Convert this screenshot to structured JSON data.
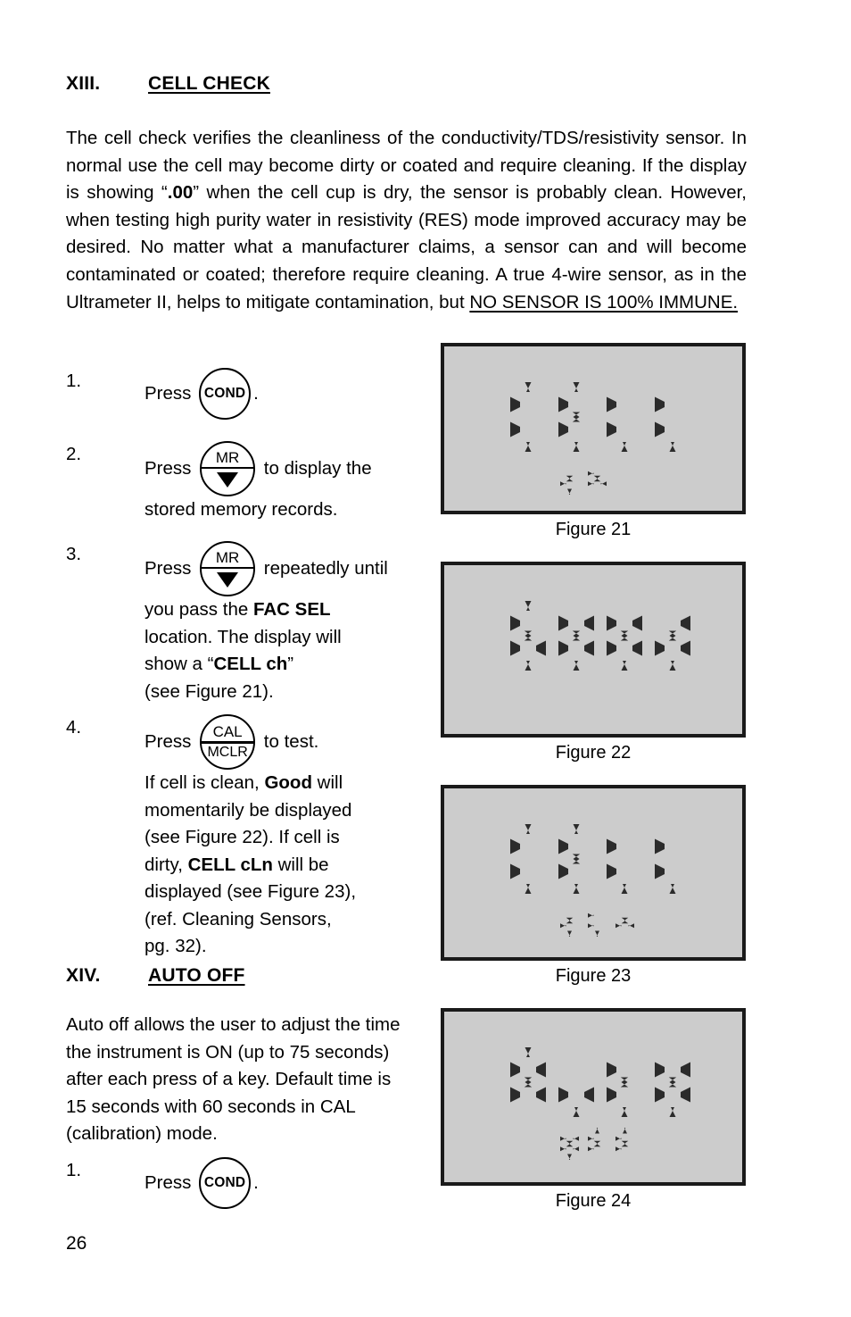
{
  "document": {
    "page_number": "26"
  },
  "sections": {
    "cell_check": {
      "numeral": "XIII.",
      "title": "CELL CHECK",
      "paragraph_parts": [
        {
          "t": "The cell check verifies the cleanliness of the conductivity/TDS/resistivity sensor. In normal use the cell may become dirty or coated and require cleaning. If the display is showing “"
        },
        {
          "t": ".00",
          "bold": true
        },
        {
          "t": "” when the cell cup is dry, the sensor is probably clean. However, when testing high purity water in resistivity (RES) mode improved accuracy may be desired. No matter what a manufacturer claims, a sensor can and will become contaminated or coated; therefore require cleaning. A true 4-wire sensor, as in the Ultrameter II, helps to mitigate contamination, but "
        },
        {
          "t": "NO SENSOR IS 100%  IMMUNE.",
          "underline": true
        }
      ]
    },
    "auto_off": {
      "numeral": "XIV.",
      "title": "AUTO OFF",
      "paragraph": "Auto off allows the user to adjust the time the instrument is ON (up to 75 seconds) after each press of a key. Default time is 15 seconds with 60 seconds in CAL (calibration) mode."
    }
  },
  "steps_cell_check": [
    {
      "index": "1.",
      "lines": [
        {
          "runs": [
            {
              "kind": "text",
              "text": "Press "
            },
            {
              "kind": "key",
              "style": "single",
              "label": "COND"
            },
            {
              "kind": "text",
              "text": "."
            }
          ]
        }
      ]
    },
    {
      "index": "2.",
      "lines": [
        {
          "runs": [
            {
              "kind": "text",
              "text": "Press "
            },
            {
              "kind": "key",
              "style": "split-arrow",
              "top": "MR",
              "bottom": "▼"
            },
            {
              "kind": "text",
              "text": " to display the"
            }
          ]
        },
        {
          "runs": [
            {
              "kind": "text",
              "text": "stored memory records."
            }
          ]
        }
      ]
    },
    {
      "index": "3.",
      "lines": [
        {
          "runs": [
            {
              "kind": "text",
              "text": "Press "
            },
            {
              "kind": "key",
              "style": "split-arrow",
              "top": "MR",
              "bottom": "▼"
            },
            {
              "kind": "text",
              "text": " repeatedly until"
            }
          ]
        },
        {
          "runs": [
            {
              "kind": "text",
              "text": "you pass the "
            },
            {
              "kind": "text",
              "text": "FAC SEL",
              "bold": true
            }
          ]
        },
        {
          "runs": [
            {
              "kind": "text",
              "text": "location. The display will"
            }
          ]
        },
        {
          "runs": [
            {
              "kind": "text",
              "text": "show a “"
            },
            {
              "kind": "text",
              "text": "CELL ch",
              "bold": true
            },
            {
              "kind": "text",
              "text": "”"
            }
          ]
        },
        {
          "runs": [
            {
              "kind": "text",
              "text": "(see Figure 21)."
            }
          ]
        }
      ]
    },
    {
      "index": "4.",
      "lines": [
        {
          "runs": [
            {
              "kind": "text",
              "text": "Press "
            },
            {
              "kind": "key",
              "style": "split-text",
              "top": "CAL",
              "bottom": "MCLR"
            },
            {
              "kind": "text",
              "text": " to test."
            }
          ]
        },
        {
          "runs": [
            {
              "kind": "text",
              "text": "If cell is clean, "
            },
            {
              "kind": "text",
              "text": "Good",
              "bold": true
            },
            {
              "kind": "text",
              "text": " will"
            }
          ]
        },
        {
          "runs": [
            {
              "kind": "text",
              "text": "momentarily be displayed"
            }
          ]
        },
        {
          "runs": [
            {
              "kind": "text",
              "text": "(see Figure 22). If cell is"
            }
          ]
        },
        {
          "runs": [
            {
              "kind": "text",
              "text": "dirty, "
            },
            {
              "kind": "text",
              "text": "CELL cLn",
              "bold": true
            },
            {
              "kind": "text",
              "text": " will be"
            }
          ]
        },
        {
          "runs": [
            {
              "kind": "text",
              "text": "displayed (see Figure 23),"
            }
          ]
        },
        {
          "runs": [
            {
              "kind": "text",
              "text": "(ref. Cleaning Sensors,"
            }
          ]
        },
        {
          "runs": [
            {
              "kind": "text",
              "text": "pg. 32)."
            }
          ]
        }
      ]
    }
  ],
  "steps_auto_off": [
    {
      "index": "1.",
      "lines": [
        {
          "runs": [
            {
              "kind": "text",
              "text": "Press "
            },
            {
              "kind": "key",
              "style": "single",
              "label": "COND"
            },
            {
              "kind": "text",
              "text": "."
            }
          ]
        }
      ]
    }
  ],
  "figures": [
    {
      "id": "figure-21",
      "caption": "Figure 21",
      "lcd": {
        "background": "#cccccc",
        "segment_color": "#2b2b2b",
        "main_text": "CELL",
        "sub_text": "ch",
        "sub_offset_chars": 1
      }
    },
    {
      "id": "figure-22",
      "caption": "Figure 22",
      "lcd": {
        "background": "#cccccc",
        "segment_color": "#2b2b2b",
        "main_text": "Good",
        "sub_text": "",
        "sub_offset_chars": 0
      }
    },
    {
      "id": "figure-23",
      "caption": "Figure 23",
      "lcd": {
        "background": "#cccccc",
        "segment_color": "#2b2b2b",
        "main_text": "CELL",
        "sub_text": "cLn",
        "sub_offset_chars": 1
      }
    },
    {
      "id": "figure-24",
      "caption": "Figure 24",
      "lcd": {
        "background": "#cccccc",
        "segment_color": "#2b2b2b",
        "main_text": "Auto",
        "sub_text": "oFF",
        "sub_offset_chars": 1
      }
    }
  ]
}
